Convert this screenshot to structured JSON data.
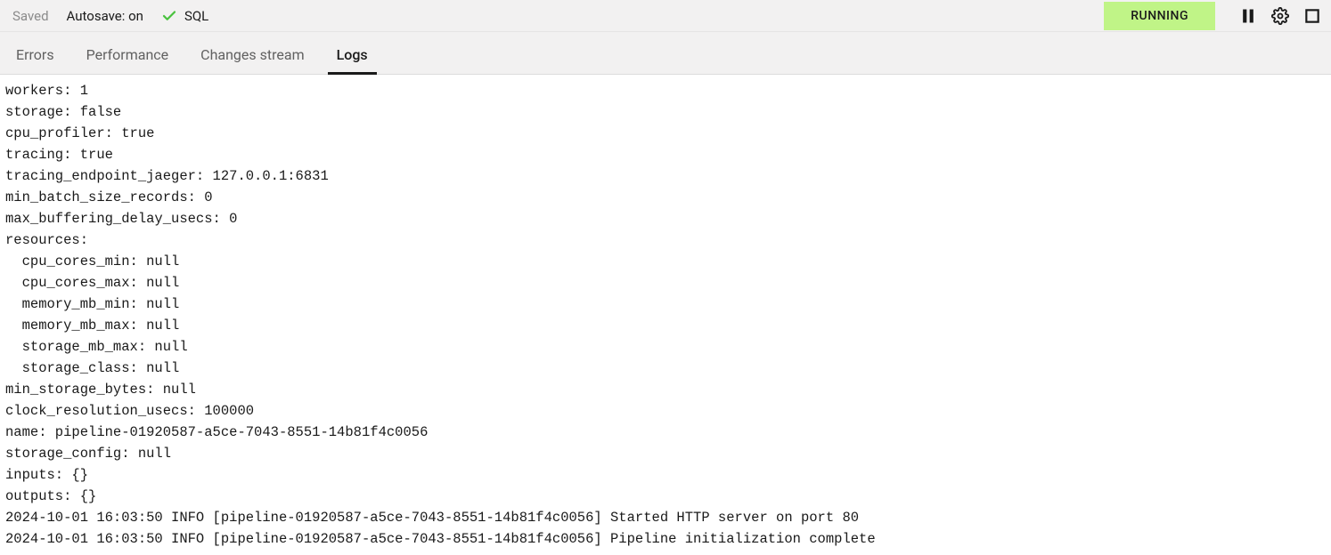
{
  "toolbar": {
    "saved": "Saved",
    "autosave": "Autosave: on",
    "sql": "SQL",
    "status": "RUNNING"
  },
  "tabs": [
    {
      "id": "errors",
      "label": "Errors",
      "active": false
    },
    {
      "id": "performance",
      "label": "Performance",
      "active": false
    },
    {
      "id": "changes",
      "label": "Changes stream",
      "active": false
    },
    {
      "id": "logs",
      "label": "Logs",
      "active": true
    }
  ],
  "logs": {
    "lines": [
      "workers: 1",
      "storage: false",
      "cpu_profiler: true",
      "tracing: true",
      "tracing_endpoint_jaeger: 127.0.0.1:6831",
      "min_batch_size_records: 0",
      "max_buffering_delay_usecs: 0",
      "resources:",
      "  cpu_cores_min: null",
      "  cpu_cores_max: null",
      "  memory_mb_min: null",
      "  memory_mb_max: null",
      "  storage_mb_max: null",
      "  storage_class: null",
      "min_storage_bytes: null",
      "clock_resolution_usecs: 100000",
      "name: pipeline-01920587-a5ce-7043-8551-14b81f4c0056",
      "storage_config: null",
      "inputs: {}",
      "outputs: {}",
      "2024-10-01 16:03:50 INFO [pipeline-01920587-a5ce-7043-8551-14b81f4c0056] Started HTTP server on port 80",
      "2024-10-01 16:03:50 INFO [pipeline-01920587-a5ce-7043-8551-14b81f4c0056] Pipeline initialization complete"
    ]
  }
}
